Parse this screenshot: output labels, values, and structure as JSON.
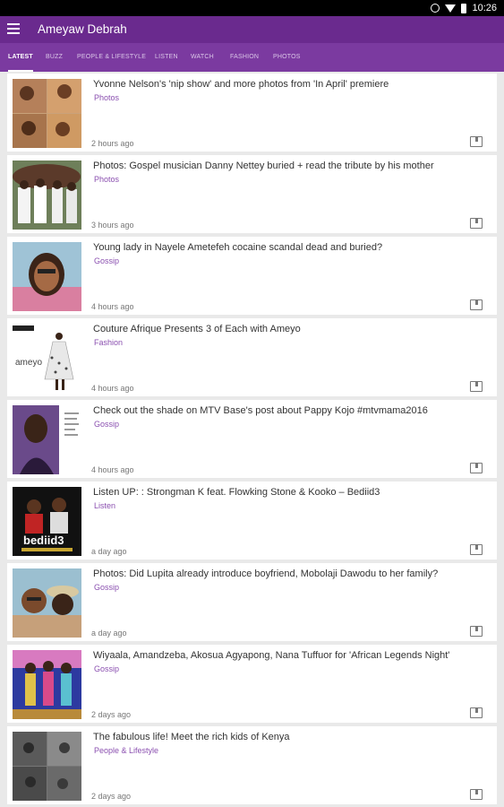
{
  "status_bar": {
    "time": "10:26"
  },
  "app_bar": {
    "title": "Ameyaw Debrah"
  },
  "tabs": [
    {
      "label": "LATEST",
      "active": true
    },
    {
      "label": "BUZZ",
      "active": false
    },
    {
      "label": "PEOPLE & LIFESTYLE",
      "active": false
    },
    {
      "label": "LISTEN",
      "active": false
    },
    {
      "label": "WATCH",
      "active": false
    },
    {
      "label": "FASHION",
      "active": false
    },
    {
      "label": "PHOTOS",
      "active": false
    }
  ],
  "articles": [
    {
      "headline": "Yvonne Nelson's 'nip show' and more photos from 'In April' premiere",
      "category": "Photos",
      "time": "2 hours ago"
    },
    {
      "headline": "Photos: Gospel musician Danny Nettey buried + read the tribute by his mother",
      "category": "Photos",
      "time": "3 hours ago"
    },
    {
      "headline": "Young lady in Nayele Ametefeh cocaine scandal dead and buried?",
      "category": "Gossip",
      "time": "4 hours ago"
    },
    {
      "headline": "Couture Afrique Presents 3 of Each with Ameyo",
      "category": "Fashion",
      "time": "4 hours ago"
    },
    {
      "headline": "Check out the shade on MTV Base's post about Pappy Kojo #mtvmama2016",
      "category": "Gossip",
      "time": "4 hours ago"
    },
    {
      "headline": "Listen UP: : Strongman K feat. Flowking Stone & Kooko – Bediid3",
      "category": "Listen",
      "time": "a day ago"
    },
    {
      "headline": "Photos: Did Lupita already introduce boyfriend, Mobolaji Dawodu to her family?",
      "category": "Gossip",
      "time": "a day ago"
    },
    {
      "headline": "Wiyaala, Amandzeba, Akosua Agyapong, Nana Tuffuor for 'African Legends Night'",
      "category": "Gossip",
      "time": "2 days ago"
    },
    {
      "headline": "The fabulous life! Meet the rich kids of Kenya",
      "category": "People & Lifestyle",
      "time": "2 days ago"
    }
  ],
  "thumb_text": {
    "ameyo": "ameyo",
    "bediid3": "bediid3"
  }
}
